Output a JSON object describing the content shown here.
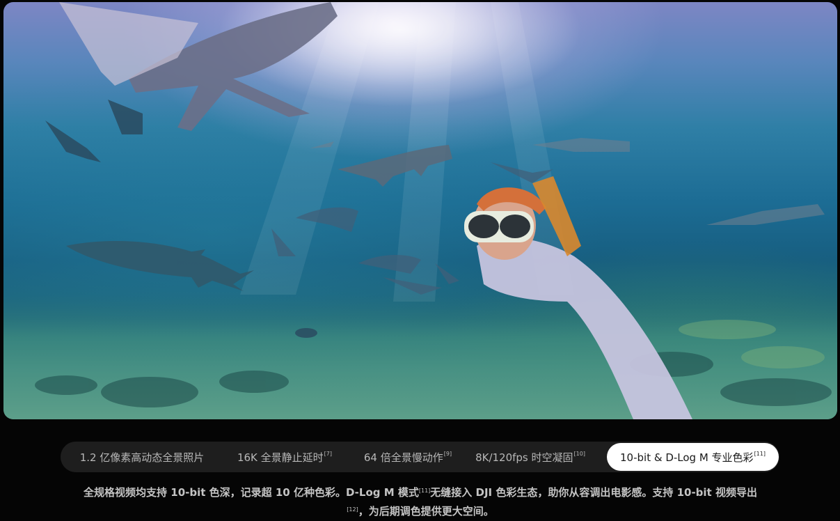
{
  "hero": {
    "alt": ""
  },
  "tabs": [
    {
      "label": "1.2 亿像素高动态全景照片",
      "note": "",
      "active": false
    },
    {
      "label": "16K 全景静止延时",
      "note": "[7]",
      "active": false
    },
    {
      "label": "64 倍全景慢动作",
      "note": "[9]",
      "active": false
    },
    {
      "label": "8K/120fps 时空凝固",
      "note": "[10]",
      "active": false
    },
    {
      "label": "10-bit & D-Log M 专业色彩",
      "note": "[11]",
      "active": true
    }
  ],
  "caption": {
    "part1": "全规格视频均支持 10-bit 色深，记录超 10 亿种色彩。D-Log M 模式",
    "note1": "[11]",
    "part2": "无缝接入 DJI 色彩生态，助你从容调出电影感。支持 10-bit 视频导出",
    "note2": "[12]",
    "part3": "，为后期调色提供更大空间。"
  },
  "colors": {
    "background": "#050505",
    "tabbar": "#1e1e1e",
    "active_tab": "#ffffff",
    "text": "#b8b8b8"
  }
}
